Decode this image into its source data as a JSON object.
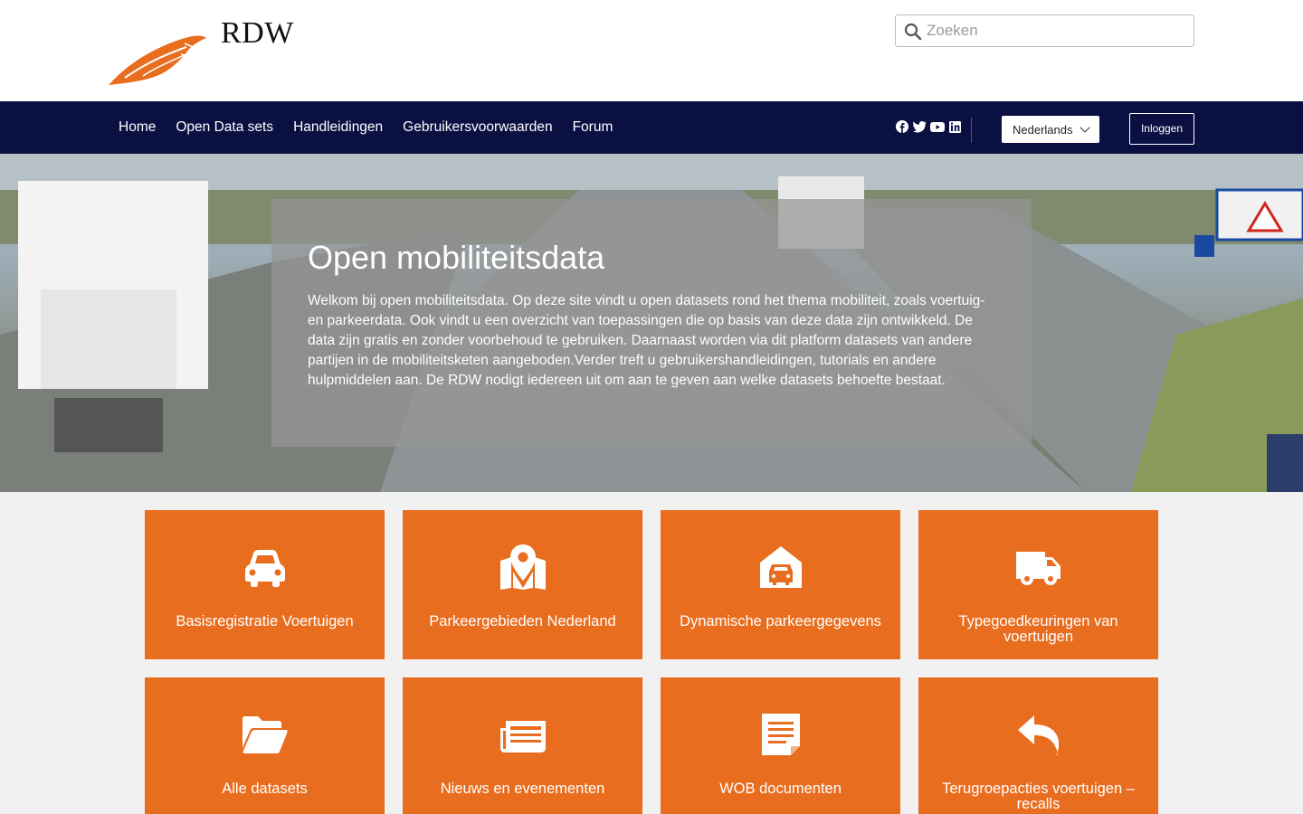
{
  "header": {
    "logo_text": "RDW",
    "search_placeholder": "Zoeken"
  },
  "nav": {
    "links": [
      "Home",
      "Open Data sets",
      "Handleidingen",
      "Gebruikersvoorwaarden",
      "Forum"
    ],
    "social_icons": [
      "facebook-icon",
      "twitter-icon",
      "youtube-icon",
      "linkedin-icon"
    ],
    "language": "Nederlands",
    "login_label": "Inloggen"
  },
  "hero": {
    "title": "Open mobiliteitsdata",
    "text": "Welkom bij open mobiliteitsdata. Op deze site vindt u open datasets rond het thema mobiliteit, zoals voertuig- en parkeerdata. Ook vindt u een overzicht van toepassingen die op basis van deze data zijn ontwikkeld. De data zijn gratis en zonder voorbehoud te gebruiken. Daarnaast worden via dit platform datasets van andere partijen in de mobiliteitsketen aangeboden.Verder treft u gebruikershandleidingen, tutorials en andere hulpmiddelen aan. De RDW nodigt iedereen uit om aan te geven aan welke datasets behoefte bestaat."
  },
  "tiles": [
    {
      "label": "Basisregistratie Voertuigen",
      "icon": "car-icon"
    },
    {
      "label": "Parkeergebieden Nederland",
      "icon": "map-marker-icon"
    },
    {
      "label": "Dynamische parkeergegevens",
      "icon": "garage-car-icon"
    },
    {
      "label": "Typegoedkeuringen van voertuigen",
      "icon": "truck-icon"
    },
    {
      "label": "Alle datasets",
      "icon": "folder-open-icon"
    },
    {
      "label": "Nieuws en evenementen",
      "icon": "newspaper-icon"
    },
    {
      "label": "WOB documenten",
      "icon": "document-icon"
    },
    {
      "label": "Terugroepacties voertuigen – recalls",
      "icon": "reply-icon"
    }
  ],
  "colors": {
    "brand_orange": "#e96d1f",
    "nav_bg": "#0b1042"
  }
}
